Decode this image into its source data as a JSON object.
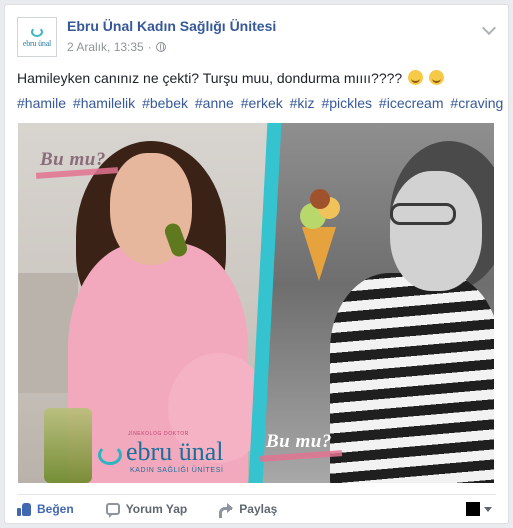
{
  "post": {
    "page_name": "Ebru Ünal Kadın Sağlığı Ünitesi",
    "timestamp": "2 Aralık, 13:35",
    "separator": "·",
    "text": "Hamileyken canınız ne çekti? Turşu muu, dondurma mıııı????",
    "hashtags": [
      "#hamile",
      "#hamilelik",
      "#bebek",
      "#anne",
      "#erkek",
      "#kiz",
      "#pickles",
      "#icecream",
      "#craving"
    ],
    "avatar": {
      "wordmark": "ebru ünal"
    }
  },
  "image": {
    "overlay_left": "Bu mu?",
    "overlay_right": "Bu mu?",
    "brand": {
      "top_text": "JİNEKOLOG DOKTOR",
      "wordmark": "ebru ünal",
      "sub_text": "KADIN SAĞLIĞI ÜNİTESİ"
    }
  },
  "actions": {
    "like_label": "Beğen",
    "comment_label": "Yorum Yap",
    "share_label": "Paylaş"
  },
  "colors": {
    "link": "#365899",
    "accent_stripe": "#34c3cf",
    "like_blue": "#4267b2"
  }
}
